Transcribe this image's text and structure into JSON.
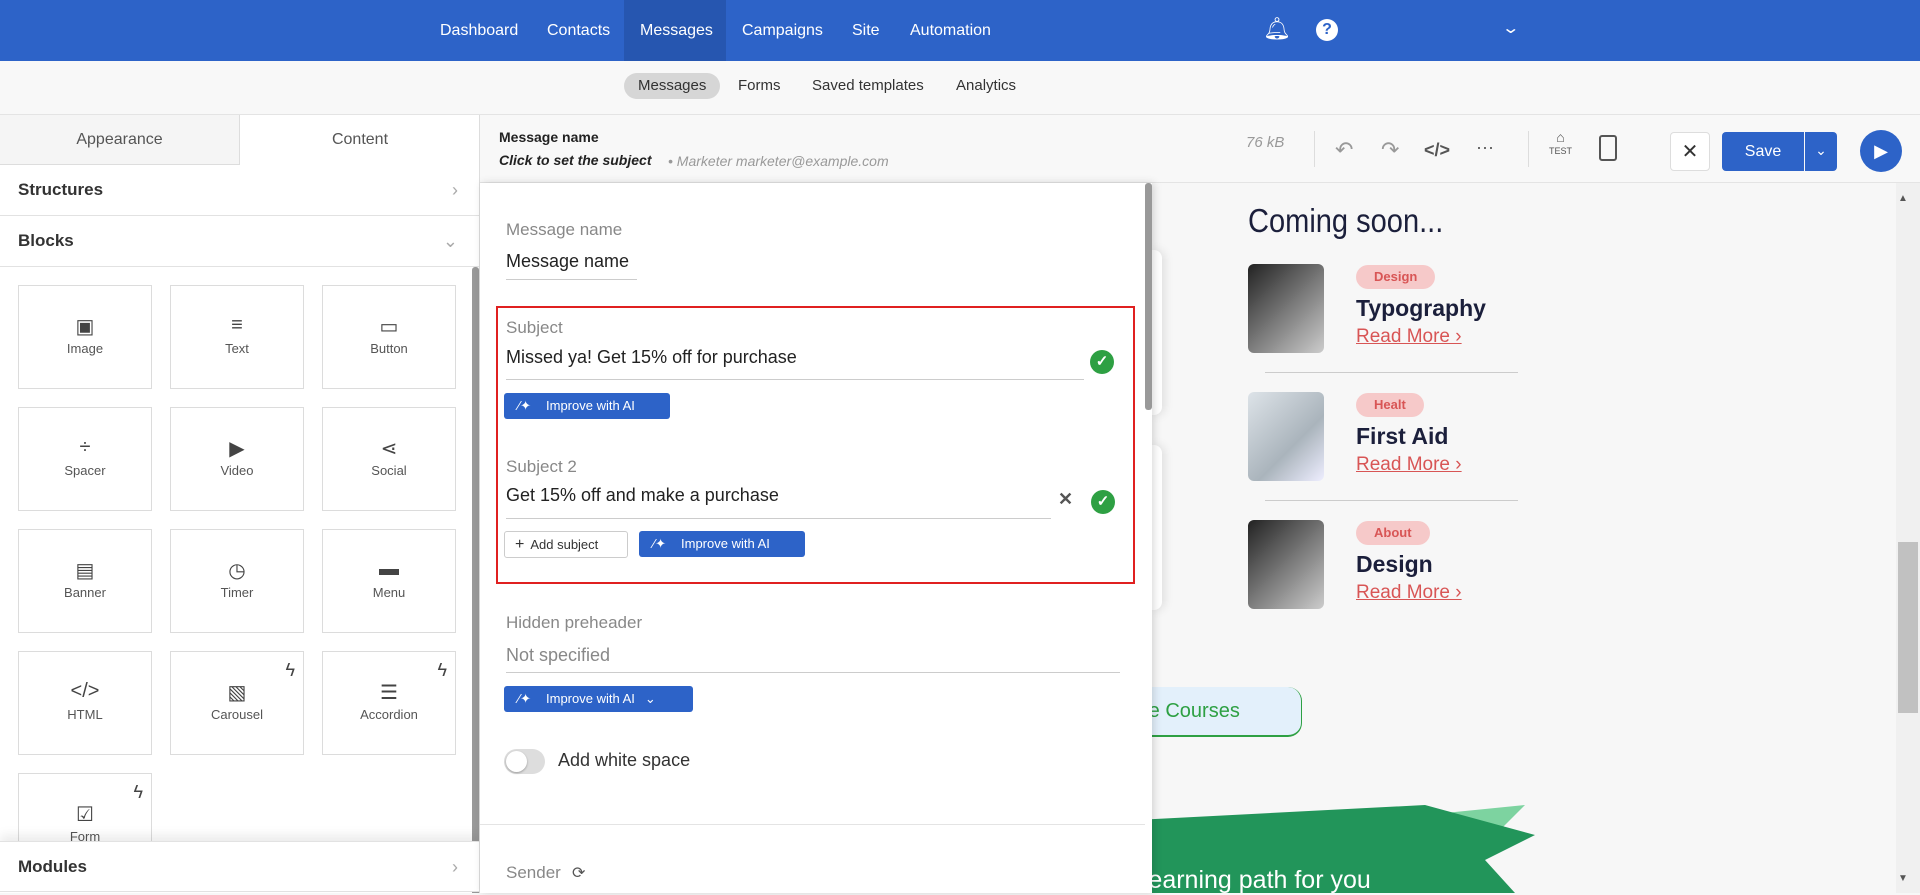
{
  "nav": {
    "items": [
      "Dashboard",
      "Contacts",
      "Messages",
      "Campaigns",
      "Site",
      "Automation"
    ],
    "active": "Messages",
    "icons": [
      "bell-icon",
      "help-icon",
      "chevron-down-icon"
    ]
  },
  "subnav": {
    "items": [
      "Messages",
      "Forms",
      "Saved templates",
      "Analytics"
    ],
    "active": "Messages"
  },
  "left": {
    "tabs": [
      "Appearance",
      "Content"
    ],
    "active_tab": "Content",
    "structures": "Structures",
    "blocks": "Blocks",
    "modules": "Modules",
    "block_items": [
      {
        "label": "Image",
        "icon": "image-icon"
      },
      {
        "label": "Text",
        "icon": "text-icon"
      },
      {
        "label": "Button",
        "icon": "button-icon"
      },
      {
        "label": "Spacer",
        "icon": "spacer-icon"
      },
      {
        "label": "Video",
        "icon": "video-icon"
      },
      {
        "label": "Social",
        "icon": "share-icon"
      },
      {
        "label": "Banner",
        "icon": "banner-icon"
      },
      {
        "label": "Timer",
        "icon": "timer-icon"
      },
      {
        "label": "Menu",
        "icon": "menu-icon"
      },
      {
        "label": "HTML",
        "icon": "code-icon"
      },
      {
        "label": "Carousel",
        "icon": "carousel-icon"
      },
      {
        "label": "Accordion",
        "icon": "accordion-icon"
      },
      {
        "label": "Form",
        "icon": "form-icon"
      }
    ]
  },
  "header": {
    "title": "Message name",
    "subject": "Click to set the subject",
    "sender": "• Marketer marketer@example.com",
    "size": "76 kB",
    "test": "TEST",
    "save": "Save"
  },
  "panel": {
    "name_label": "Message name",
    "name_value": "Message name",
    "subject_label": "Subject",
    "subject_value": "Missed ya! Get 15% off for purchase",
    "improve": "Improve with AI",
    "subject2_label": "Subject 2",
    "subject2_value": "Get 15% off and make a purchase",
    "add_subject": "Add subject",
    "preheader_label": "Hidden preheader",
    "preheader_value": "Not specified",
    "white_space": "Add white space",
    "white_space_on": false,
    "sender_label": "Sender"
  },
  "preview": {
    "heading": "Coming soon...",
    "cards": [
      {
        "tag": "Design",
        "title": "Typography",
        "link": "Read More ›"
      },
      {
        "tag": "Healt",
        "title": "First Aid",
        "link": "Read More ›"
      },
      {
        "tag": "About",
        "title": "Design",
        "link": "Read More ›"
      }
    ],
    "courses_btn": "re Courses",
    "banner": "Find the right learning path for you"
  },
  "colors": {
    "brand": "#2d63c8",
    "success": "#2ea043",
    "highlight": "#e02020",
    "tag": "#d85555"
  }
}
